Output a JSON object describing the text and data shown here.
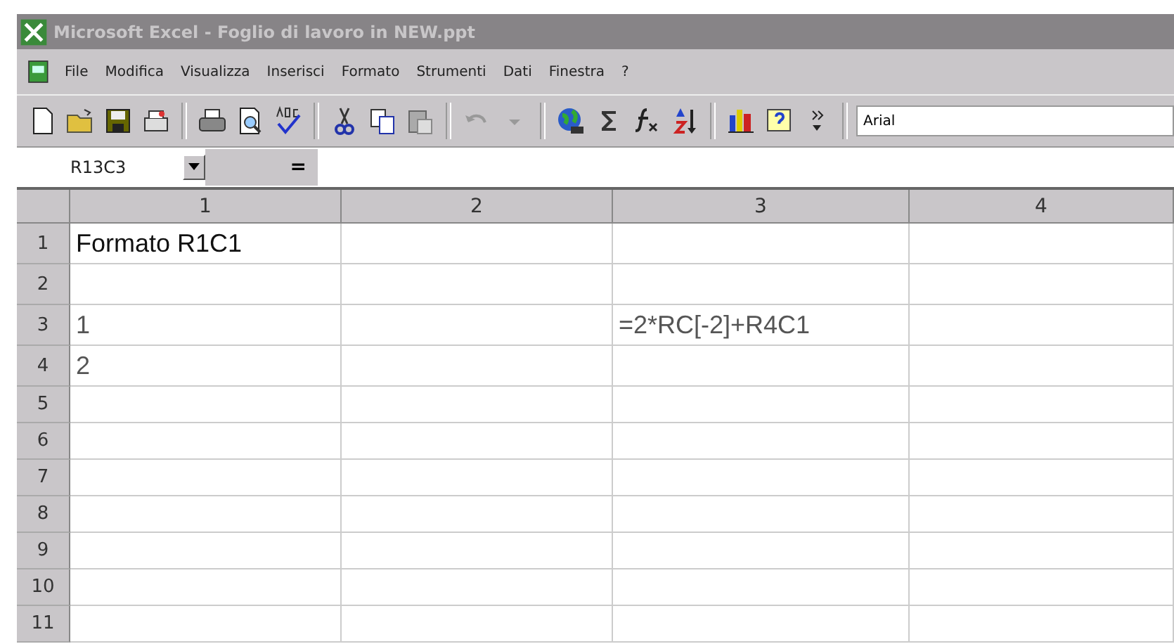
{
  "window": {
    "title": "Microsoft Excel - Foglio di lavoro in NEW.ppt"
  },
  "menu": [
    "File",
    "Modifica",
    "Visualizza",
    "Inserisci",
    "Formato",
    "Strumenti",
    "Dati",
    "Finestra",
    "?"
  ],
  "toolbar": {
    "font": "Arial"
  },
  "formula_bar": {
    "name_box": "R13C3",
    "equals": "="
  },
  "table": {
    "columns": [
      "1",
      "2",
      "3",
      "4"
    ],
    "rows": [
      {
        "header": "1",
        "cells": [
          "Formato R1C1",
          "",
          "",
          ""
        ]
      },
      {
        "header": "2",
        "cells": [
          "",
          "",
          "",
          ""
        ]
      },
      {
        "header": "3",
        "cells": [
          "1",
          "",
          "=2*RC[-2]+R4C1",
          ""
        ]
      },
      {
        "header": "4",
        "cells": [
          "2",
          "",
          "",
          ""
        ]
      },
      {
        "header": "5",
        "cells": [
          "",
          "",
          "",
          ""
        ]
      },
      {
        "header": "6",
        "cells": [
          "",
          "",
          "",
          ""
        ]
      },
      {
        "header": "7",
        "cells": [
          "",
          "",
          "",
          ""
        ]
      },
      {
        "header": "8",
        "cells": [
          "",
          "",
          "",
          ""
        ]
      },
      {
        "header": "9",
        "cells": [
          "",
          "",
          "",
          ""
        ]
      },
      {
        "header": "10",
        "cells": [
          "",
          "",
          "",
          ""
        ]
      },
      {
        "header": "11",
        "cells": [
          "",
          "",
          "",
          ""
        ]
      }
    ]
  }
}
